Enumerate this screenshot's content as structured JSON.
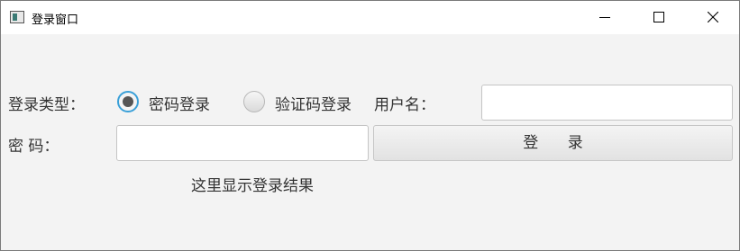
{
  "window": {
    "title": "登录窗口"
  },
  "form": {
    "login_type_label": "登录类型：",
    "radio_password_label": "密码登录",
    "radio_code_label": "验证码登录",
    "selected_login_type": "密码登录",
    "username_label": "用户名：",
    "username_value": "",
    "password_label": "密    码：",
    "password_value": "",
    "login_button_label": "登      录",
    "result_text": "这里显示登录结果"
  },
  "icons": {
    "app": "app-window-icon",
    "minimize": "minimize-icon",
    "maximize": "maximize-icon",
    "close": "close-icon"
  },
  "colors": {
    "radio_focus": "#3aa0d8",
    "background": "#f3f3f3"
  }
}
